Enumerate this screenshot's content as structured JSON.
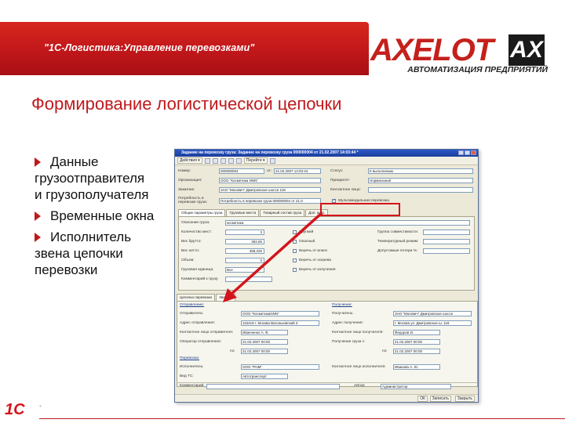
{
  "banner": {
    "text": "\"1С-Логистика:Управление перевозками\""
  },
  "logo": {
    "word": "AXELOT",
    "mark": "AX",
    "subtitle": "АВТОМАТИЗАЦИЯ ПРЕДПРИЯТИЙ"
  },
  "title": "Формирование логистической цепочки",
  "bullets": [
    {
      "line1": "Данные",
      "rest": [
        "грузоотправителя",
        "и грузополучателя"
      ]
    },
    {
      "line1": "Временные окна",
      "rest": []
    },
    {
      "line1": "Исполнитель",
      "rest": [
        "звена цепочки",
        "перевозки"
      ]
    }
  ],
  "window": {
    "title": "Задание на перевозку груза: Задание на перевозку груза 000000004 от 21.02.2007 14:03:44 *",
    "toolbar": {
      "actions": "Действия ▾",
      "goto": "Перейти ▾"
    },
    "fields": {
      "number_label": "Номер:",
      "number_value": "000000004",
      "date_label": "от:",
      "date_value": "21.02.2007 14:03:44",
      "status_label": "Статус:",
      "status_value": "К выполнению",
      "org_label": "Организация:",
      "org_value": "ООО \"Косметика NNN\"",
      "priority_label": "Приоритет:",
      "priority_value": "Нормальный",
      "customer_label": "Заказчик:",
      "customer_value": "ЗАО \"Москвич\" Дмитровское шоссе 118",
      "contact_label": "Контактное лицо:",
      "contact_value": "",
      "need_label": "Потребность в перевозке груза:",
      "need_value": "Потребность в перевозке груза 000000004 от 21.0",
      "multi_label": "Мультимодальная перевозка"
    },
    "tabs_top": [
      "Общие параметры груза",
      "Грузовые места",
      "Товарный состав груза",
      "Доп. инф."
    ],
    "cargo": {
      "desc_label": "Описание груза:",
      "desc_value": "косметика",
      "qty_label": "Количество мест:",
      "qty_value": "3",
      "gross_label": "Вес брутто:",
      "gross_value": "362,65",
      "net_label": "Вес нетто:",
      "net_value": "459,225",
      "volume_label": "Объем:",
      "volume_value": "0",
      "unit_label": "Грузовая единица:",
      "unit_value": "Все",
      "comment_label": "Комментарий к грузу:",
      "c1": "Хрупкий",
      "c2": "Опасный",
      "c3": "Беречь от влаги",
      "c4": "Беречь от нагрева",
      "c5": "Беречь от излучения",
      "compat_label": "Группа совместимости:",
      "temp_label": "Температурный режим:",
      "loss_label": "Допустимые потери %:"
    },
    "tabs_chain": [
      "Цепочка перевозки",
      "Звено 1"
    ],
    "sender": {
      "heading": "Отправление:",
      "shipper_label": "Отправитель:",
      "shipper_value": "ООО \"КосметикаNNN\"",
      "addr_label": "Адрес отправления:",
      "addr_value": "115419 г. Москва Вагоньковский 3",
      "contact_label": "Контактное лицо отправителя:",
      "contact_value": "Иванченко А. Ф.",
      "window_label": "Оператор отправления:",
      "from_value": "21.02.2007 00:00",
      "to_label": "по:",
      "to_value": "21.02.2007 00:00"
    },
    "receiver": {
      "heading": "Получение:",
      "consignee_label": "Получатель:",
      "consignee_value": "ЗАО \"Москвич\" Дмитровское шоссе",
      "addr_label": "Адрес получения:",
      "addr_value": "г. Москва ул. Дмитровское ш. 118",
      "contact_label": "Контактное лицо получателя:",
      "contact_value": "Федоров И.",
      "window_label": "Получение груза с:",
      "from_value": "21.02.2007 00:00",
      "to_label": "по:",
      "to_value": "21.02.2007 00:00"
    },
    "carrier": {
      "heading": "Перевозка:",
      "executor_label": "Исполнитель:",
      "executor_value": "ООО \"РНМ\"",
      "exec_contact_label": "Контактное лицо исполнителя:",
      "exec_contact_value": "Иванова А. Ю.",
      "vehicle_label": "Вид ТС:",
      "vehicle_value": "Автотранспорт"
    },
    "bottom": {
      "comment_label": "Комментарий:",
      "author_label": "Автор:",
      "author_value": "Администратор"
    },
    "status": {
      "ok": "ОК",
      "save": "Записать",
      "close": "Закрыть"
    }
  },
  "footer": {
    "onec": "1С",
    "tm": "®"
  },
  "colors": {
    "brand_red": "#c0191c",
    "highlight": "#d4141c"
  }
}
